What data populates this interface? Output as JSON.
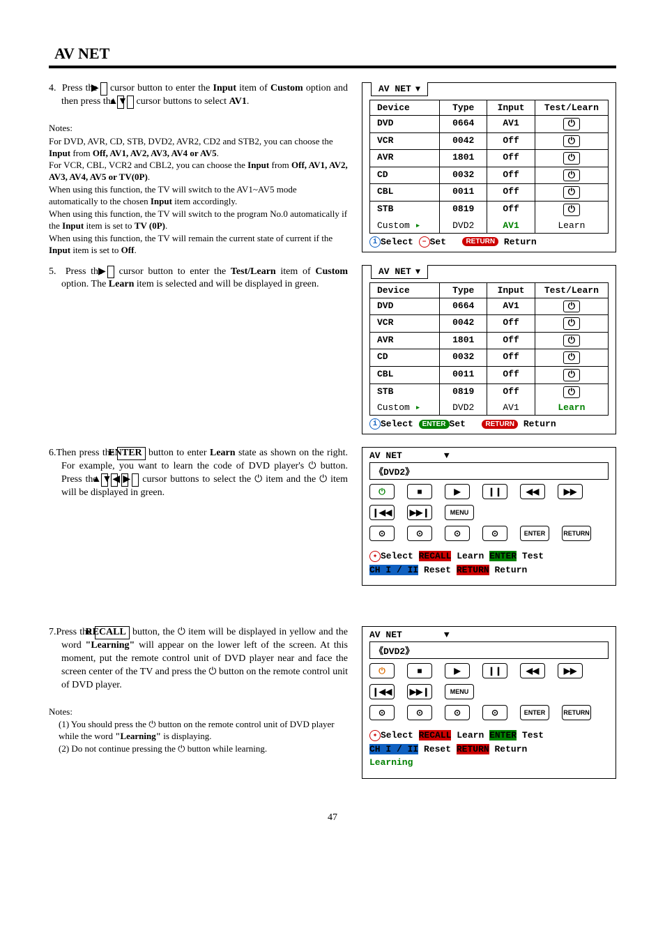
{
  "page_title": "AV NET",
  "page_number": "47",
  "step4": {
    "label": "4.",
    "text_a": "Press the ",
    "cursor_right": "▶",
    "text_b": " cursor button to enter the ",
    "bold_input": "Input",
    "text_c": " item of ",
    "bold_custom": "Custom",
    "text_d": " option and then press the ",
    "cursor_up": "▲",
    "cursor_down": "▼",
    "text_e": " cursor buttons to select ",
    "bold_av1": "AV1",
    "text_f": "."
  },
  "notes4": {
    "title": "Notes:",
    "l1": "For DVD, AVR, CD, STB, DVD2, AVR2, CD2 and STB2, you can choose the ",
    "l1b": "Input",
    "l1c": " from ",
    "l1_opts": "Off, AV1, AV2, AV3, AV4 or AV5",
    "l1d": ".",
    "l2": "For VCR, CBL, VCR2 and CBL2, you can choose the ",
    "l2b": "Input",
    "l2c": " from ",
    "l2_opts": "Off, AV1, AV2, AV3, AV4, AV5 or TV(0P)",
    "l2d": ".",
    "l3a": "When using this function, the TV will switch to the AV1~AV5 mode automatically to the chosen ",
    "l3b": "Input",
    "l3c": " item accordingly.",
    "l4a": "When using this function, the TV will switch to the program No.0 automatically if the ",
    "l4b": "Input",
    "l4c": " item is set to ",
    "l4d": "TV (0P)",
    "l4e": ".",
    "l5a": "When using this function, the TV will remain the current state of current if the ",
    "l5b": "Input",
    "l5c": " item is set to ",
    "l5d": "Off",
    "l5e": "."
  },
  "step5": {
    "label": "5.",
    "text_a": "Press the ",
    "cursor_right": "▶",
    "text_b": " cursor button to enter the ",
    "bold_test": "Test/Learn",
    "text_c": " item of ",
    "bold_custom": "Custom",
    "text_d": " option. The ",
    "bold_learn": "Learn",
    "text_e": " item is selected and will be displayed in green."
  },
  "step6": {
    "label": "6.",
    "text_a": "Then press the ",
    "enter": "ENTER",
    "text_b": " button to enter ",
    "bold_learn": "Learn",
    "text_c": " state as shown on the right. For example, you want to learn the code of DVD player's ",
    "pwr": "⏻",
    "text_d": " button. Press the ",
    "up": "▲",
    "down": "▼",
    "left": "◀",
    "right": "▶",
    "text_e": " cursor buttons to select the ",
    "text_f": " item and the ",
    "text_g": " item will be displayed in green."
  },
  "step7": {
    "label": "7.",
    "text_a": "Press the ",
    "recall": "RECALL",
    "text_b": " button, the ",
    "pwr": "⏻",
    "text_c": " item will be displayed in yellow and the word ",
    "learning": "\"Learning\"",
    "text_d": " will appear on the lower left of the screen. At this moment, put the remote control unit of DVD player near and face the screen center of the TV and press the ",
    "text_e": " button on the remote control unit of DVD player."
  },
  "notes7": {
    "title": "Notes:",
    "l1a": "(1) You should press the ",
    "pwr": "⏻",
    "l1b": " button on the remote control unit of DVD player while the word ",
    "l1c": "\"Learning\"",
    "l1d": " is displaying.",
    "l2a": "(2) Do not continue pressing the ",
    "l2b": " button while learning."
  },
  "panel": {
    "tab": "AV NET",
    "tri": "▼",
    "headers": {
      "device": "Device",
      "type": "Type",
      "input": "Input",
      "test": "Test/Learn"
    },
    "footer": {
      "select": "Select",
      "set": "Set",
      "return_pill": "RETURN",
      "return": "Return",
      "enter_pill": "ENTER"
    }
  },
  "table1_rows": [
    {
      "device": "DVD",
      "type": "0664",
      "input": "AV1",
      "test_btn": true
    },
    {
      "device": "VCR",
      "type": "0042",
      "input": "Off",
      "test_btn": true
    },
    {
      "device": "AVR",
      "type": "1801",
      "input": "Off",
      "test_btn": true
    },
    {
      "device": "CD",
      "type": "0032",
      "input": "Off",
      "test_btn": true
    },
    {
      "device": "CBL",
      "type": "0011",
      "input": "Off",
      "test_btn": true
    },
    {
      "device": "STB",
      "type": "0819",
      "input": "Off",
      "test_btn": true
    }
  ],
  "table1_custom": {
    "device": "Custom",
    "type": "DVD2",
    "input": "AV1",
    "test": "Learn",
    "input_green": true
  },
  "table2_custom": {
    "device": "Custom",
    "type": "DVD2",
    "input": "AV1",
    "test": "Learn",
    "test_green": true
  },
  "remote": {
    "title": "AV NET",
    "tri": "▼",
    "sub": "《DVD2》",
    "icons": {
      "power": "⏻",
      "stop": "■",
      "play": "▶",
      "pause": "❙❙",
      "rw": "◀◀",
      "ff": "▶▶",
      "prev": "❙◀◀",
      "next": "▶▶❙",
      "menu": "MENU",
      "d1": "⊙",
      "d2": "⊙",
      "d3": "⊙",
      "d4": "⊙",
      "enter": "ENTER",
      "return": "RETURN"
    },
    "footer": {
      "select": "Select",
      "recall": "RECALL",
      "learn": "Learn",
      "enter": "ENTER",
      "test": "Test",
      "chi": "CH I / II",
      "reset": "Reset",
      "return_pill": "RETURN",
      "return": "Return",
      "learning": "Learning"
    }
  }
}
